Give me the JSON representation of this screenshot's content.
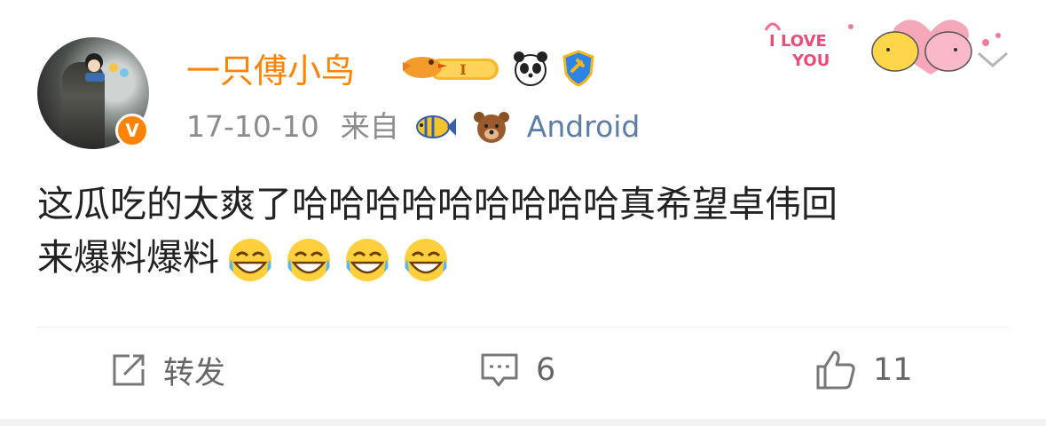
{
  "post": {
    "username": "一只傅小鸟",
    "level_badge": "I",
    "date": "17-10-10",
    "from_label": "来自",
    "device": "Android",
    "text_line1": "这瓜吃的太爽了哈哈哈哈哈哈哈哈哈真希望卓伟回",
    "text_line2": "来爆料爆料",
    "verified_mark": "V",
    "decoration_text_top": "I LOVE",
    "decoration_text_bottom": "YOU"
  },
  "actions": {
    "share_label": "转发",
    "comment_count": "6",
    "like_count": "11"
  },
  "colors": {
    "username": "#ff8200",
    "device": "#5b7ea6",
    "meta": "#8c8c8c",
    "badge_orange": "#ff8200"
  },
  "icons": [
    "avatar-image",
    "verified-badge-icon",
    "bird-level-badge-icon",
    "panda-icon",
    "shield-member-icon",
    "fish-icon",
    "bear-icon",
    "love-you-decoration",
    "chevron-down-icon",
    "share-icon",
    "comment-icon",
    "thumbs-up-icon",
    "laughing-tears-emoji"
  ]
}
